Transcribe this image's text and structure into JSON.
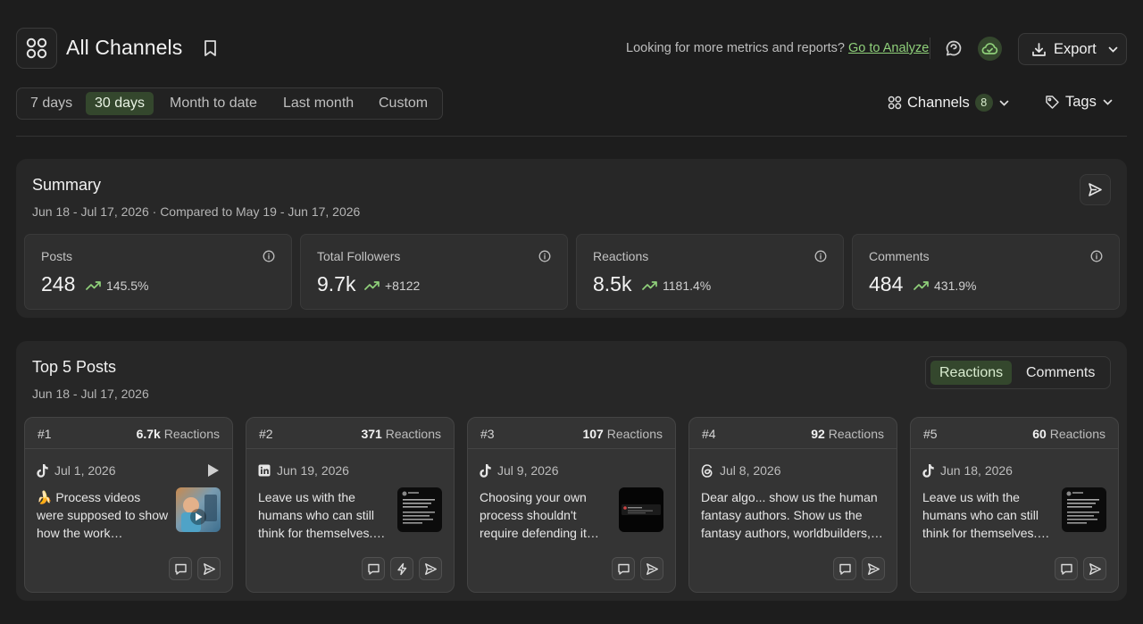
{
  "header": {
    "title": "All Channels",
    "promo_text": "Looking for more metrics and reports?",
    "promo_link": "Go to Analyze",
    "export_label": "Export"
  },
  "date_range": {
    "options": [
      "7 days",
      "30 days",
      "Month to date",
      "Last month",
      "Custom"
    ],
    "selected": "30 days"
  },
  "filters": {
    "channels_label": "Channels",
    "channels_count": "8",
    "tags_label": "Tags"
  },
  "summary": {
    "title": "Summary",
    "range_text": "Jun 18 - Jul 17, 2026 · Compared to May 19 - Jun 17, 2026",
    "metrics": [
      {
        "label": "Posts",
        "value": "248",
        "change": "145.5%"
      },
      {
        "label": "Total Followers",
        "value": "9.7k",
        "change": "+8122"
      },
      {
        "label": "Reactions",
        "value": "8.5k",
        "change": "1181.4%"
      },
      {
        "label": "Comments",
        "value": "484",
        "change": "431.9%"
      }
    ]
  },
  "top_posts": {
    "title": "Top 5 Posts",
    "range_text": "Jun 18 - Jul 17, 2026",
    "toggle": [
      "Reactions",
      "Comments"
    ],
    "toggle_selected": "Reactions",
    "reactions_word": "Reactions",
    "posts": [
      {
        "rank": "#1",
        "count": "6.7k",
        "date": "Jul 1, 2026",
        "platform": "tiktok-icon",
        "text": "🍌 Process videos were supposed to show how the work…"
      },
      {
        "rank": "#2",
        "count": "371",
        "date": "Jun 19, 2026",
        "platform": "linkedin-icon",
        "text": "Leave us with the humans who can still think for themselves.…"
      },
      {
        "rank": "#3",
        "count": "107",
        "date": "Jul 9, 2026",
        "platform": "tiktok-icon",
        "text": "Choosing your own process shouldn't require defending it…"
      },
      {
        "rank": "#4",
        "count": "92",
        "date": "Jul 8, 2026",
        "platform": "threads-icon",
        "text": "Dear algo... show us the human fantasy authors. Show us the fantasy authors, worldbuilders,…"
      },
      {
        "rank": "#5",
        "count": "60",
        "date": "Jun 18, 2026",
        "platform": "tiktok-icon",
        "text": "Leave us with the humans who can still think for themselves.…"
      }
    ]
  },
  "colors": {
    "accent_green": "#8fd07a",
    "selected_bg": "#34472d",
    "page_bg": "#1d1d1d",
    "panel_bg": "#272727"
  }
}
